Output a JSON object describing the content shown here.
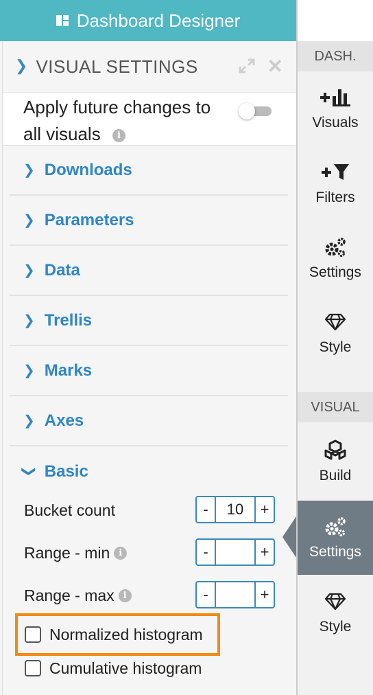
{
  "header": {
    "title": "Dashboard Designer"
  },
  "visual_settings": {
    "title": "VISUAL SETTINGS",
    "apply_line1": "Apply future changes to",
    "apply_line2": "all visuals",
    "toggle_on": false
  },
  "sections": [
    {
      "label": "Downloads",
      "open": false
    },
    {
      "label": "Parameters",
      "open": false
    },
    {
      "label": "Data",
      "open": false
    },
    {
      "label": "Trellis",
      "open": false
    },
    {
      "label": "Marks",
      "open": false
    },
    {
      "label": "Axes",
      "open": false
    },
    {
      "label": "Basic",
      "open": true
    }
  ],
  "basic": {
    "bucket_count_label": "Bucket count",
    "bucket_count_value": "10",
    "range_min_label": "Range - min",
    "range_min_value": "",
    "range_max_label": "Range - max",
    "range_max_value": "",
    "minus": "-",
    "plus": "+",
    "normalized_label": "Normalized histogram",
    "cumulative_label": "Cumulative histogram",
    "normalized_checked": false,
    "cumulative_checked": false
  },
  "rail": {
    "dash_label": "DASH.",
    "visual_label": "VISUAL",
    "items": [
      {
        "label": "Visuals",
        "icon": "add-chart-icon"
      },
      {
        "label": "Filters",
        "icon": "add-filter-icon"
      },
      {
        "label": "Settings",
        "icon": "gears-icon"
      },
      {
        "label": "Style",
        "icon": "diamond-icon"
      },
      {
        "label": "Build",
        "icon": "cubes-icon"
      },
      {
        "label": "Settings",
        "icon": "gears-icon",
        "active": true
      },
      {
        "label": "Style",
        "icon": "diamond-icon"
      }
    ]
  },
  "colors": {
    "header_bg": "#4fb8c3",
    "link_blue": "#2f86c4",
    "active_rail": "#6f7b85",
    "highlight_orange": "#f28a14"
  }
}
